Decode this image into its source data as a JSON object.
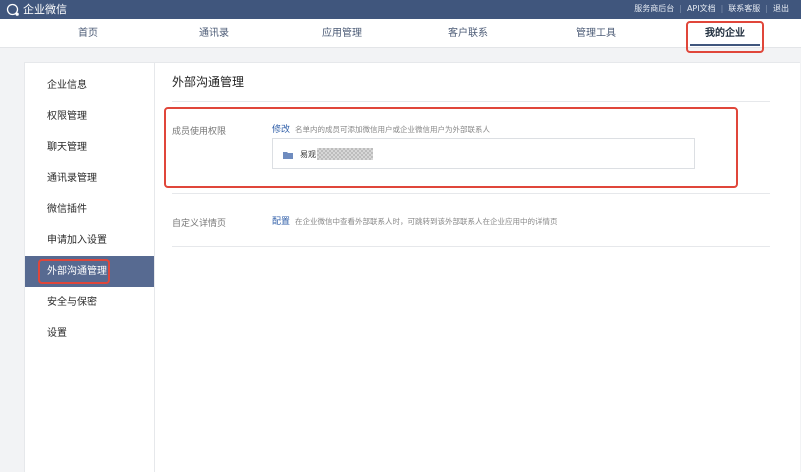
{
  "app": {
    "logo_text": "企业微信"
  },
  "toplinks": [
    "服务商后台",
    "API文档",
    "联系客服",
    "退出"
  ],
  "nav": {
    "items": [
      "首页",
      "通讯录",
      "应用管理",
      "客户联系",
      "管理工具",
      "我的企业"
    ],
    "active": "我的企业"
  },
  "sidebar": {
    "items": [
      "企业信息",
      "权限管理",
      "聊天管理",
      "通讯录管理",
      "微信插件",
      "申请加入设置",
      "外部沟通管理",
      "安全与保密",
      "设置"
    ],
    "active": "外部沟通管理"
  },
  "main": {
    "title": "外部沟通管理",
    "member_permission": {
      "label": "成员使用权限",
      "action": "修改",
      "description": "名单内的成员可添加微信用户或企业微信用户为外部联系人",
      "members": [
        {
          "name": "易观"
        }
      ]
    },
    "custom_detail": {
      "label": "自定义详情页",
      "action": "配置",
      "description": "在企业微信中查看外部联系人时，可跳转到该外部联系人在企业应用中的详情页"
    }
  },
  "colors": {
    "topbar": "#40567d",
    "active_side": "#576a91",
    "link": "#2f5ea8",
    "highlight": "#e0463a"
  }
}
